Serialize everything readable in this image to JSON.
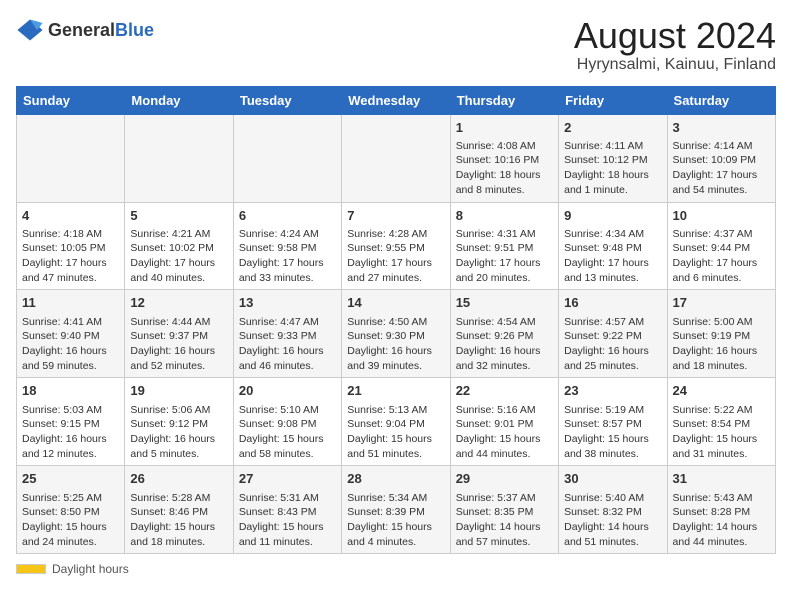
{
  "logo": {
    "general": "General",
    "blue": "Blue"
  },
  "title": "August 2024",
  "subtitle": "Hyrynsalmi, Kainuu, Finland",
  "days_of_week": [
    "Sunday",
    "Monday",
    "Tuesday",
    "Wednesday",
    "Thursday",
    "Friday",
    "Saturday"
  ],
  "footer": {
    "daylight_label": "Daylight hours"
  },
  "weeks": [
    [
      {
        "day": "",
        "info": ""
      },
      {
        "day": "",
        "info": ""
      },
      {
        "day": "",
        "info": ""
      },
      {
        "day": "",
        "info": ""
      },
      {
        "day": "1",
        "info": "Sunrise: 4:08 AM\nSunset: 10:16 PM\nDaylight: 18 hours\nand 8 minutes."
      },
      {
        "day": "2",
        "info": "Sunrise: 4:11 AM\nSunset: 10:12 PM\nDaylight: 18 hours\nand 1 minute."
      },
      {
        "day": "3",
        "info": "Sunrise: 4:14 AM\nSunset: 10:09 PM\nDaylight: 17 hours\nand 54 minutes."
      }
    ],
    [
      {
        "day": "4",
        "info": "Sunrise: 4:18 AM\nSunset: 10:05 PM\nDaylight: 17 hours\nand 47 minutes."
      },
      {
        "day": "5",
        "info": "Sunrise: 4:21 AM\nSunset: 10:02 PM\nDaylight: 17 hours\nand 40 minutes."
      },
      {
        "day": "6",
        "info": "Sunrise: 4:24 AM\nSunset: 9:58 PM\nDaylight: 17 hours\nand 33 minutes."
      },
      {
        "day": "7",
        "info": "Sunrise: 4:28 AM\nSunset: 9:55 PM\nDaylight: 17 hours\nand 27 minutes."
      },
      {
        "day": "8",
        "info": "Sunrise: 4:31 AM\nSunset: 9:51 PM\nDaylight: 17 hours\nand 20 minutes."
      },
      {
        "day": "9",
        "info": "Sunrise: 4:34 AM\nSunset: 9:48 PM\nDaylight: 17 hours\nand 13 minutes."
      },
      {
        "day": "10",
        "info": "Sunrise: 4:37 AM\nSunset: 9:44 PM\nDaylight: 17 hours\nand 6 minutes."
      }
    ],
    [
      {
        "day": "11",
        "info": "Sunrise: 4:41 AM\nSunset: 9:40 PM\nDaylight: 16 hours\nand 59 minutes."
      },
      {
        "day": "12",
        "info": "Sunrise: 4:44 AM\nSunset: 9:37 PM\nDaylight: 16 hours\nand 52 minutes."
      },
      {
        "day": "13",
        "info": "Sunrise: 4:47 AM\nSunset: 9:33 PM\nDaylight: 16 hours\nand 46 minutes."
      },
      {
        "day": "14",
        "info": "Sunrise: 4:50 AM\nSunset: 9:30 PM\nDaylight: 16 hours\nand 39 minutes."
      },
      {
        "day": "15",
        "info": "Sunrise: 4:54 AM\nSunset: 9:26 PM\nDaylight: 16 hours\nand 32 minutes."
      },
      {
        "day": "16",
        "info": "Sunrise: 4:57 AM\nSunset: 9:22 PM\nDaylight: 16 hours\nand 25 minutes."
      },
      {
        "day": "17",
        "info": "Sunrise: 5:00 AM\nSunset: 9:19 PM\nDaylight: 16 hours\nand 18 minutes."
      }
    ],
    [
      {
        "day": "18",
        "info": "Sunrise: 5:03 AM\nSunset: 9:15 PM\nDaylight: 16 hours\nand 12 minutes."
      },
      {
        "day": "19",
        "info": "Sunrise: 5:06 AM\nSunset: 9:12 PM\nDaylight: 16 hours\nand 5 minutes."
      },
      {
        "day": "20",
        "info": "Sunrise: 5:10 AM\nSunset: 9:08 PM\nDaylight: 15 hours\nand 58 minutes."
      },
      {
        "day": "21",
        "info": "Sunrise: 5:13 AM\nSunset: 9:04 PM\nDaylight: 15 hours\nand 51 minutes."
      },
      {
        "day": "22",
        "info": "Sunrise: 5:16 AM\nSunset: 9:01 PM\nDaylight: 15 hours\nand 44 minutes."
      },
      {
        "day": "23",
        "info": "Sunrise: 5:19 AM\nSunset: 8:57 PM\nDaylight: 15 hours\nand 38 minutes."
      },
      {
        "day": "24",
        "info": "Sunrise: 5:22 AM\nSunset: 8:54 PM\nDaylight: 15 hours\nand 31 minutes."
      }
    ],
    [
      {
        "day": "25",
        "info": "Sunrise: 5:25 AM\nSunset: 8:50 PM\nDaylight: 15 hours\nand 24 minutes."
      },
      {
        "day": "26",
        "info": "Sunrise: 5:28 AM\nSunset: 8:46 PM\nDaylight: 15 hours\nand 18 minutes."
      },
      {
        "day": "27",
        "info": "Sunrise: 5:31 AM\nSunset: 8:43 PM\nDaylight: 15 hours\nand 11 minutes."
      },
      {
        "day": "28",
        "info": "Sunrise: 5:34 AM\nSunset: 8:39 PM\nDaylight: 15 hours\nand 4 minutes."
      },
      {
        "day": "29",
        "info": "Sunrise: 5:37 AM\nSunset: 8:35 PM\nDaylight: 14 hours\nand 57 minutes."
      },
      {
        "day": "30",
        "info": "Sunrise: 5:40 AM\nSunset: 8:32 PM\nDaylight: 14 hours\nand 51 minutes."
      },
      {
        "day": "31",
        "info": "Sunrise: 5:43 AM\nSunset: 8:28 PM\nDaylight: 14 hours\nand 44 minutes."
      }
    ]
  ]
}
